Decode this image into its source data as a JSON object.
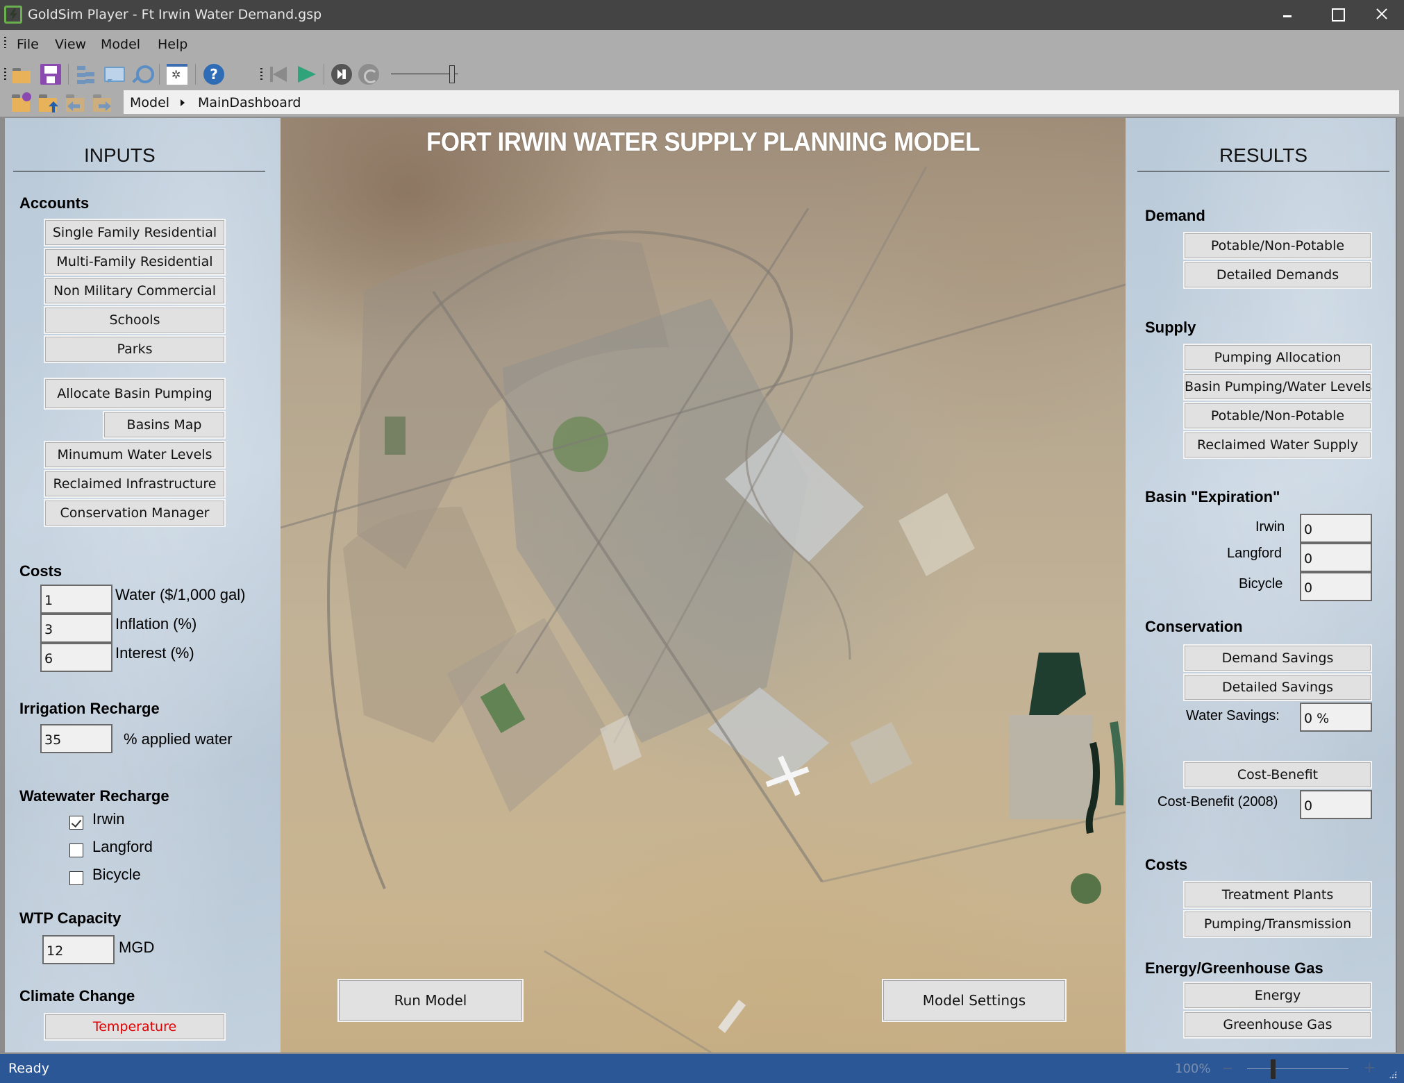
{
  "window": {
    "title": "GoldSim Player - Ft Irwin Water Demand.gsp",
    "controls": [
      "minimize",
      "maximize",
      "close"
    ]
  },
  "menu": {
    "items": [
      "File",
      "View",
      "Model",
      "Help"
    ]
  },
  "toolbar": {
    "icons": [
      "open-folder-icon",
      "save-icon",
      "model-tree-icon",
      "comment-icon",
      "search-icon",
      "settings-window-icon",
      "help-icon",
      "first-step-icon",
      "play-icon",
      "step-icon",
      "reset-icon"
    ],
    "help_glyph": "?"
  },
  "navigation": {
    "icons": [
      "home-folder-icon",
      "folder-up-icon",
      "folder-back-icon",
      "folder-forward-icon"
    ],
    "breadcrumb": [
      "Model",
      "MainDashboard"
    ]
  },
  "inputs": {
    "heading": "INPUTS",
    "accounts": {
      "label": "Accounts",
      "buttons": [
        "Single Family Residential",
        "Multi-Family Residential",
        "Non Military Commercial",
        "Schools",
        "Parks"
      ]
    },
    "basin_buttons": {
      "allocate": "Allocate Basin Pumping",
      "map": "Basins Map",
      "others": [
        "Minumum Water Levels",
        "Reclaimed Infrastructure",
        "Conservation Manager"
      ]
    },
    "costs": {
      "label": "Costs",
      "fields": [
        {
          "value": "1",
          "label": "Water ($/1,000 gal)"
        },
        {
          "value": "3",
          "label": "Inflation (%)"
        },
        {
          "value": "6",
          "label": "Interest (%)"
        }
      ]
    },
    "irrigation": {
      "label": "Irrigation Recharge",
      "value": "35",
      "unit": "% applied water"
    },
    "wastewater": {
      "label": "Watewater Recharge",
      "options": [
        {
          "label": "Irwin",
          "checked": true
        },
        {
          "label": "Langford",
          "checked": false
        },
        {
          "label": "Bicycle",
          "checked": false
        }
      ]
    },
    "wtp": {
      "label": "WTP Capacity",
      "value": "12",
      "unit": "MGD"
    },
    "climate": {
      "label": "Climate Change",
      "button": "Temperature",
      "button_color": "#e00000"
    }
  },
  "map": {
    "title": "FORT IRWIN WATER SUPPLY PLANNING MODEL",
    "run_button": "Run Model",
    "settings_button": "Model Settings"
  },
  "results": {
    "heading": "RESULTS",
    "demand": {
      "label": "Demand",
      "buttons": [
        "Potable/Non-Potable",
        "Detailed Demands"
      ]
    },
    "supply": {
      "label": "Supply",
      "buttons": [
        "Pumping Allocation",
        "Basin Pumping/Water Levels",
        "Potable/Non-Potable",
        "Reclaimed Water Supply"
      ]
    },
    "expiration": {
      "label": "Basin \"Expiration\"",
      "fields": [
        {
          "label": "Irwin",
          "value": "0"
        },
        {
          "label": "Langford",
          "value": "0"
        },
        {
          "label": "Bicycle",
          "value": "0"
        }
      ]
    },
    "conservation": {
      "label": "Conservation",
      "buttons": [
        "Demand Savings",
        "Detailed Savings"
      ],
      "savings_label": "Water Savings:",
      "savings_value": "0 %",
      "cost_benefit_button": "Cost-Benefit",
      "cost_benefit_label": "Cost-Benefit (2008)",
      "cost_benefit_value": "0"
    },
    "costs": {
      "label": "Costs",
      "buttons": [
        "Treatment Plants",
        "Pumping/Transmission"
      ]
    },
    "energy": {
      "label": "Energy/Greenhouse Gas",
      "buttons": [
        "Energy",
        "Greenhouse Gas"
      ]
    }
  },
  "status": {
    "text": "Ready",
    "zoom": "100%",
    "zoom_minus": "−",
    "zoom_plus": "+"
  },
  "colors": {
    "titlebar": "#444444",
    "chrome": "#adadad",
    "statusbar": "#2b5797",
    "button_face": "#e1e1e1",
    "panel": "#c0cedb"
  }
}
